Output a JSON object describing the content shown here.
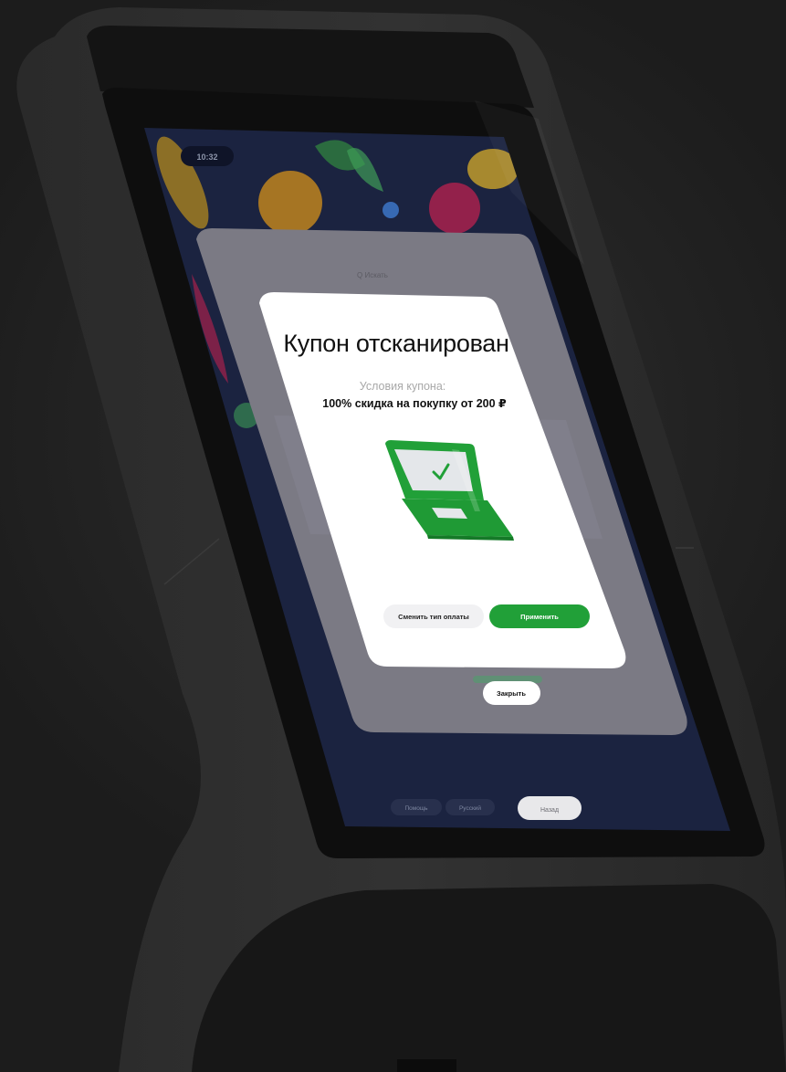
{
  "status_bar": {
    "time": "10:32"
  },
  "background_panel": {
    "search_text": "Q Искать"
  },
  "modal": {
    "title": "Купон отсканирован",
    "conditions_label": "Условия купона:",
    "conditions_value": "100% скидка на покупку от 200 ₽",
    "illustration_icon": "laptop-check-icon",
    "buttons": {
      "change_payment": "Сменить тип оплаты",
      "apply": "Применить"
    }
  },
  "close_button": {
    "label": "Закрыть"
  },
  "bottom_bar": {
    "help": "Помощь",
    "language": "Русский",
    "back": "Назад"
  },
  "colors": {
    "accent_green": "#21a038",
    "screen_bg": "#1b2340",
    "kiosk_body": "#2b2b2b"
  }
}
